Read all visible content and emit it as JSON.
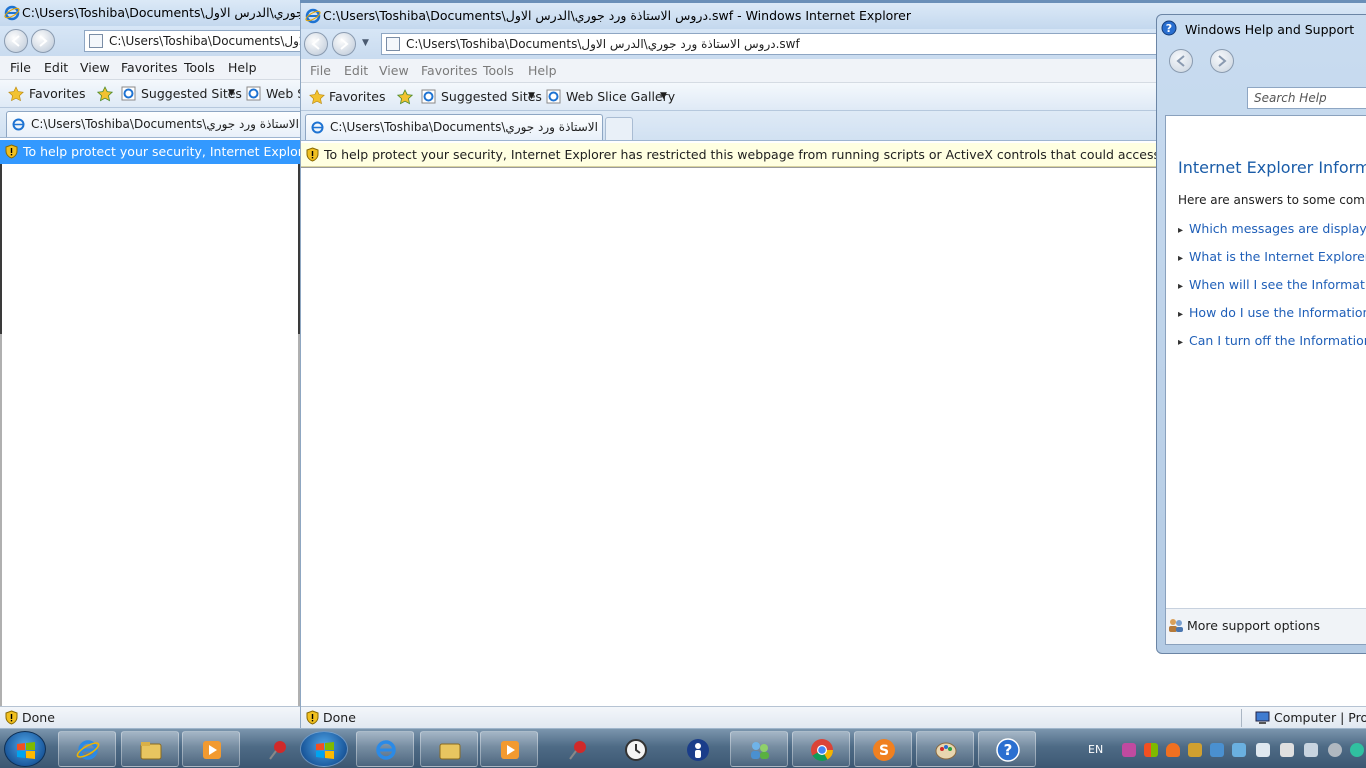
{
  "back_window": {
    "title": "C:\\Users\\Toshiba\\Documents\\دروس الاستاذة ورد جوري\\الدرس الاول",
    "address": "C:\\Users\\Toshiba\\Documents\\الدرس الاول",
    "menu": [
      "File",
      "Edit",
      "View",
      "Favorites",
      "Tools",
      "Help"
    ],
    "favorites_label": "Favorites",
    "suggested_sites": "Suggested Sites",
    "web_slice": "Web S",
    "tab_label": "C:\\Users\\Toshiba\\Documents\\دروس الاستاذة ورد جوري",
    "infobar_text": "To help protect your security, Internet Explorer has re",
    "status": "Done"
  },
  "main_window": {
    "title": "C:\\Users\\Toshiba\\Documents\\دروس الاستاذة ورد جوري\\الدرس الاول.swf - Windows Internet Explorer",
    "address": "C:\\Users\\Toshiba\\Documents\\دروس الاستاذة ورد جوري\\الدرس الاول.swf",
    "menu": [
      "File",
      "Edit",
      "View",
      "Favorites",
      "Tools",
      "Help"
    ],
    "favorites_label": "Favorites",
    "suggested_sites": "Suggested Sites",
    "web_slice": "Web Slice Gallery",
    "tab_label": "C:\\Users\\Toshiba\\Documents\\دروس الاستاذة ورد جوري...",
    "infobar_text": "To help protect your security, Internet Explorer has restricted this webpage from running scripts or ActiveX controls that could access your computer. Click here",
    "status": "Done",
    "zone": "Computer | Protec"
  },
  "help_window": {
    "title": "Windows Help and Support",
    "search_placeholder": "Search Help",
    "heading": "Internet Explorer Informatio",
    "intro": "Here are answers to some common q",
    "questions": [
      "Which messages are displayed in th",
      "What is the Internet Explorer Infor",
      "When will I see the Information bar",
      "How do I use the Information bar?",
      "Can I turn off the Information bar?"
    ],
    "more_support": "More support options"
  },
  "taskbar": {
    "language": "EN"
  },
  "colors": {
    "infobar_selected": "#3399ff",
    "infobar_normal": "#ffffe1",
    "link": "#1f5fb8"
  }
}
